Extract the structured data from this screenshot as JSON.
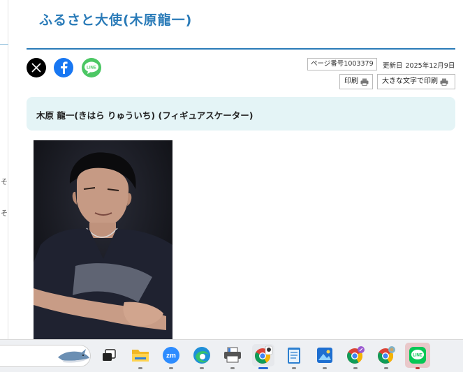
{
  "page": {
    "title": "ふるさと大使(木原龍一)",
    "left_glyphs": [
      "そ",
      "そ"
    ]
  },
  "meta": {
    "page_number": "ページ番号1003379",
    "updated_label": "更新日",
    "updated_date": "2025年12月9日"
  },
  "share": {
    "x": "x-icon",
    "facebook": "facebook-icon",
    "line": "line-icon",
    "line_text": "LINE"
  },
  "buttons": {
    "print": "印刷",
    "print_large": "大きな文字で印刷"
  },
  "content": {
    "heading": "木原 龍一(きはら りゅういち) (フィギュアスケーター)"
  },
  "taskbar": {
    "apps": [
      {
        "name": "shark-widget"
      },
      {
        "name": "task-view"
      },
      {
        "name": "file-explorer"
      },
      {
        "name": "zoom",
        "label": "zm"
      },
      {
        "name": "edge"
      },
      {
        "name": "printer"
      },
      {
        "name": "chrome-profile"
      },
      {
        "name": "notepad"
      },
      {
        "name": "photos"
      },
      {
        "name": "chrome-profile-2"
      },
      {
        "name": "chrome-profile-3"
      },
      {
        "name": "line",
        "label": "LINE"
      }
    ]
  },
  "colors": {
    "accent": "#2a7bb8",
    "heading_bg": "#e4f4f6",
    "facebook": "#1877f2",
    "line": "#4cc764"
  }
}
